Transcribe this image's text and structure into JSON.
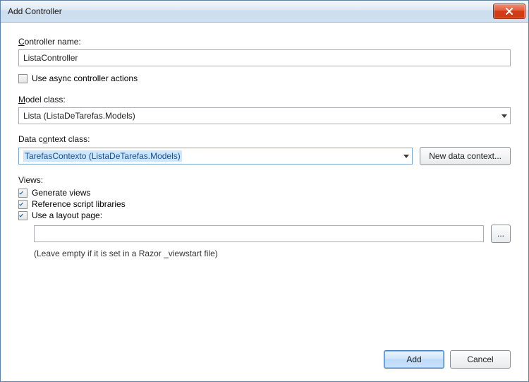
{
  "window": {
    "title": "Add Controller"
  },
  "form": {
    "controllerName": {
      "label_pre": "",
      "label_ul": "C",
      "label_post": "ontroller name:",
      "value": "ListaController"
    },
    "asyncCheckbox": {
      "checked": false,
      "label": "Use async controller actions"
    },
    "modelClass": {
      "label_pre": "",
      "label_ul": "M",
      "label_post": "odel class:",
      "value": "Lista (ListaDeTarefas.Models)"
    },
    "dataContext": {
      "label_pre": "Data c",
      "label_ul": "o",
      "label_post": "ntext class:",
      "value": "TarefasContexto (ListaDeTarefas.Models)",
      "newButton": "New data context..."
    },
    "views": {
      "heading": "Views:",
      "generate": {
        "checked": true,
        "label": "Generate views"
      },
      "reference": {
        "checked": true,
        "label": "Reference script libraries"
      },
      "layout": {
        "checked": true,
        "label": "Use a layout page:"
      },
      "layoutPath": "",
      "browse": "...",
      "hint": "(Leave empty if it is set in a Razor _viewstart file)"
    }
  },
  "buttons": {
    "add": "Add",
    "cancel": "Cancel"
  }
}
